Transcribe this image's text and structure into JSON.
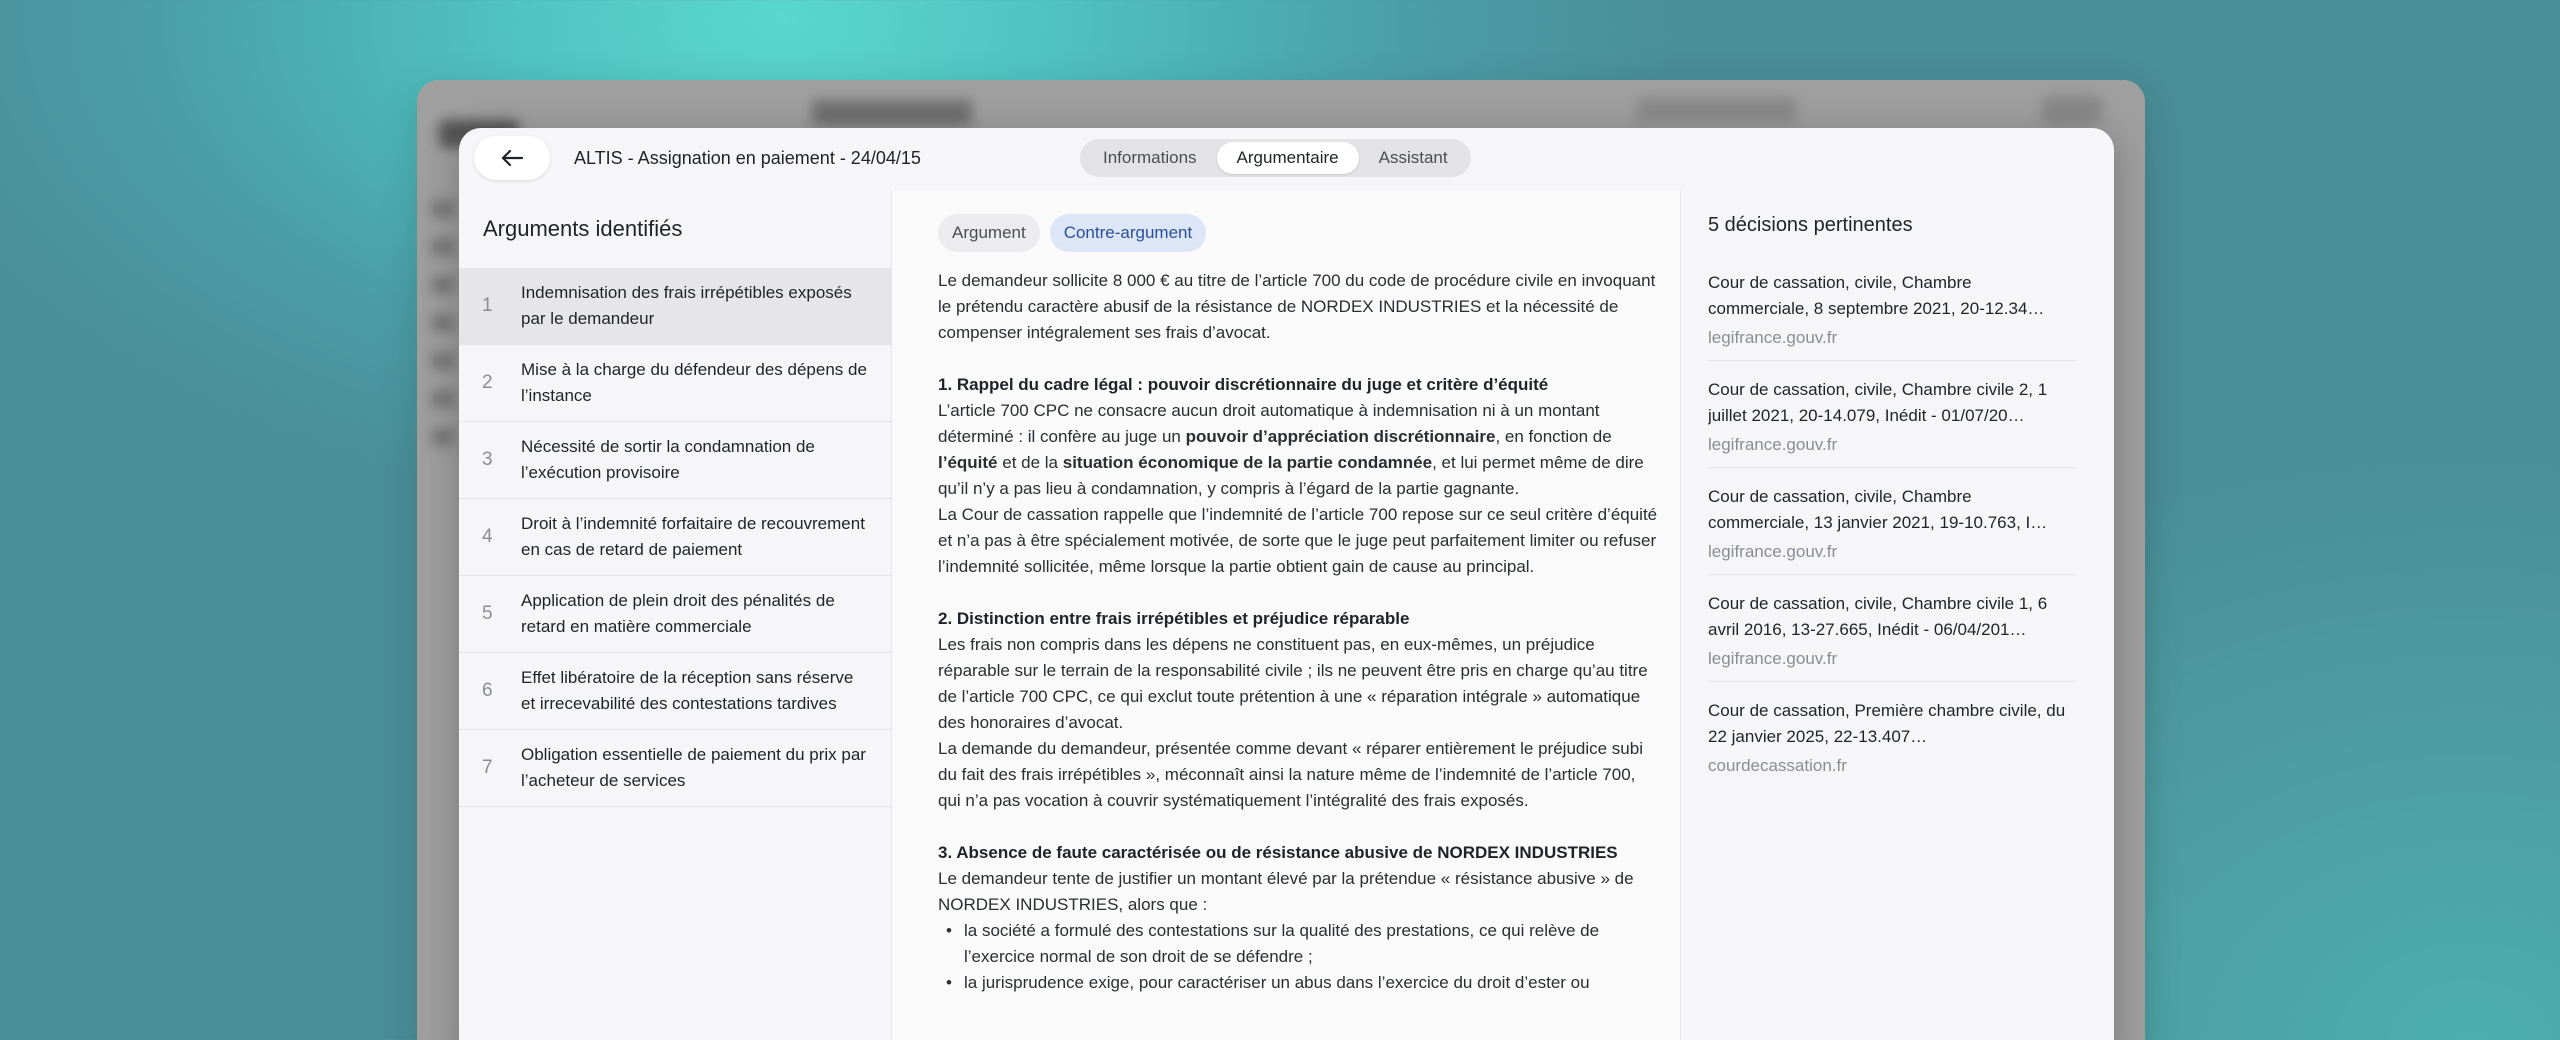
{
  "header": {
    "title": "ALTIS - Assignation en paiement - 24/04/15",
    "tabs": [
      {
        "label": "Informations",
        "active": false
      },
      {
        "label": "Argumentaire",
        "active": true
      },
      {
        "label": "Assistant",
        "active": false
      }
    ]
  },
  "left": {
    "title": "Arguments identifiés",
    "items": [
      {
        "num": "1",
        "label": "Indemnisation des frais irrépétibles exposés par le demandeur",
        "selected": true
      },
      {
        "num": "2",
        "label": "Mise à la charge du défendeur des dépens de l’instance"
      },
      {
        "num": "3",
        "label": "Nécessité de sortir la condamnation de l’exécution provisoire"
      },
      {
        "num": "4",
        "label": "Droit à l’indemnité forfaitaire de recouvrement en cas de retard de paiement"
      },
      {
        "num": "5",
        "label": "Application de plein droit des pénalités de retard en matière commerciale"
      },
      {
        "num": "6",
        "label": "Effet libératoire de la réception sans réserve et irrecevabilité des contestations tardives"
      },
      {
        "num": "7",
        "label": "Obligation essentielle de paiement du prix par l’acheteur de services"
      }
    ]
  },
  "middle": {
    "chips": {
      "argument": "Argument",
      "counter": "Contre-argument"
    },
    "intro": "Le demandeur sollicite 8 000 € au titre de l’article 700 du code de procédure civile en invoquant le prétendu caractère abusif de la résistance de NORDEX INDUSTRIES et la nécessité de compenser intégralement ses frais d’avocat.",
    "s1": {
      "heading": "1. Rappel du cadre légal : pouvoir discrétionnaire du juge et critère d’équité",
      "p1a": "L’article 700 CPC ne consacre aucun droit automatique à indemnisation ni à un montant déterminé : il confère au juge un ",
      "p1b": "pouvoir d’appréciation discrétionnaire",
      "p1c": ", en fonction de ",
      "p1d": "l’équité",
      "p1e": " et de la ",
      "p1f": "situation économique de la partie condamnée",
      "p1g": ", et lui permet même de dire qu’il n’y a pas lieu à condamnation, y compris à l’égard de la partie gagnante.",
      "p2": "La Cour de cassation rappelle que l’indemnité de l’article 700 repose sur ce seul critère d’équité et n’a pas à être spécialement motivée, de sorte que le juge peut parfaitement limiter ou refuser l’indemnité sollicitée, même lorsque la partie obtient gain de cause au principal."
    },
    "s2": {
      "heading": "2. Distinction entre frais irrépétibles et préjudice réparable",
      "p1": "Les frais non compris dans les dépens ne constituent pas, en eux-mêmes, un préjudice réparable sur le terrain de la responsabilité civile ; ils ne peuvent être pris en charge qu’au titre de l’article 700 CPC, ce qui exclut toute prétention à une « réparation intégrale » automatique des honoraires d’avocat.",
      "p2": "La demande du demandeur, présentée comme devant « réparer entièrement le préjudice subi du fait des frais irrépétibles », méconnaît ainsi la nature même de l’indemnité de l’article 700, qui n’a pas vocation à couvrir systématiquement l’intégralité des frais exposés."
    },
    "s3": {
      "heading": "3. Absence de faute caractérisée ou de résistance abusive de NORDEX INDUSTRIES",
      "p1": "Le demandeur tente de justifier un montant élevé par la prétendue « résistance abusive » de NORDEX INDUSTRIES, alors que :",
      "b1": "la société a formulé des contestations sur la qualité des prestations, ce qui relève de l’exercice normal de son droit de se défendre ;",
      "b2": "la jurisprudence exige, pour caractériser un abus dans l’exercice du droit d’ester ou"
    }
  },
  "right": {
    "title": "5 décisions pertinentes",
    "items": [
      {
        "title": "Cour de cassation, civile, Chambre commerciale, 8 septembre 2021, 20-12.34…",
        "source": "legifrance.gouv.fr"
      },
      {
        "title": "Cour de cassation, civile, Chambre civile 2, 1 juillet 2021, 20-14.079, Inédit - 01/07/20…",
        "source": "legifrance.gouv.fr"
      },
      {
        "title": "Cour de cassation, civile, Chambre commerciale, 13 janvier 2021, 19-10.763, I…",
        "source": "legifrance.gouv.fr"
      },
      {
        "title": "Cour de cassation, civile, Chambre civile 1, 6 avril 2016, 13-27.665, Inédit - 06/04/201…",
        "source": "legifrance.gouv.fr"
      },
      {
        "title": "Cour de cassation, Première chambre civile, du 22 janvier 2025, 22-13.407…",
        "source": "courdecassation.fr"
      }
    ]
  },
  "icons": {
    "back": "arrow-left-icon"
  }
}
